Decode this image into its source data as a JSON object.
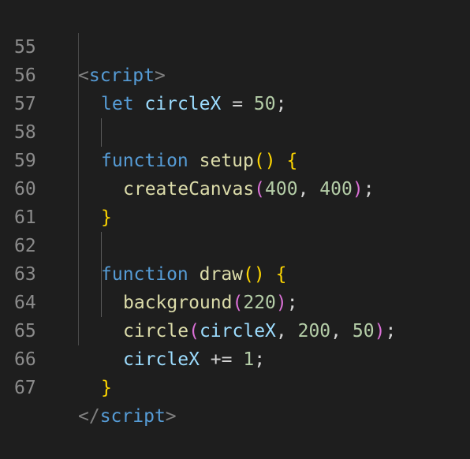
{
  "editor": {
    "lines": [
      {
        "number": "55",
        "tokens": {
          "t0": "<",
          "t1": "script",
          "t2": ">"
        }
      },
      {
        "number": "56",
        "tokens": {
          "t0": "let",
          "t1": "circleX",
          "t2": "=",
          "t3": "50",
          "t4": ";"
        }
      },
      {
        "number": "57",
        "tokens": {}
      },
      {
        "number": "58",
        "tokens": {
          "t0": "function",
          "t1": "setup",
          "t2": "()",
          "t3": "{"
        }
      },
      {
        "number": "59",
        "tokens": {
          "t0": "createCanvas",
          "t1": "(",
          "t2": "400",
          "t3": ",",
          "t4": "400",
          "t5": ")",
          "t6": ";"
        }
      },
      {
        "number": "60",
        "tokens": {
          "t0": "}"
        }
      },
      {
        "number": "61",
        "tokens": {}
      },
      {
        "number": "62",
        "tokens": {
          "t0": "function",
          "t1": "draw",
          "t2": "()",
          "t3": "{"
        }
      },
      {
        "number": "63",
        "tokens": {
          "t0": "background",
          "t1": "(",
          "t2": "220",
          "t3": ")",
          "t4": ";"
        }
      },
      {
        "number": "64",
        "tokens": {
          "t0": "circle",
          "t1": "(",
          "t2": "circleX",
          "t3": ",",
          "t4": "200",
          "t5": ",",
          "t6": "50",
          "t7": ")",
          "t8": ";"
        }
      },
      {
        "number": "65",
        "tokens": {
          "t0": "circleX",
          "t1": "+=",
          "t2": "1",
          "t3": ";"
        }
      },
      {
        "number": "66",
        "tokens": {
          "t0": "}"
        }
      },
      {
        "number": "67",
        "tokens": {
          "t0": "</",
          "t1": "script",
          "t2": ">"
        }
      }
    ]
  },
  "colors": {
    "background": "#1e1e1e",
    "line_number": "#8b8b8b",
    "keyword": "#569cd6",
    "variable": "#9cdcfe",
    "function": "#dcdcaa",
    "number": "#b5cea8",
    "bracket_level_1": "#ffd700",
    "bracket_level_2": "#da70d6",
    "tag_punctuation": "#808080"
  }
}
